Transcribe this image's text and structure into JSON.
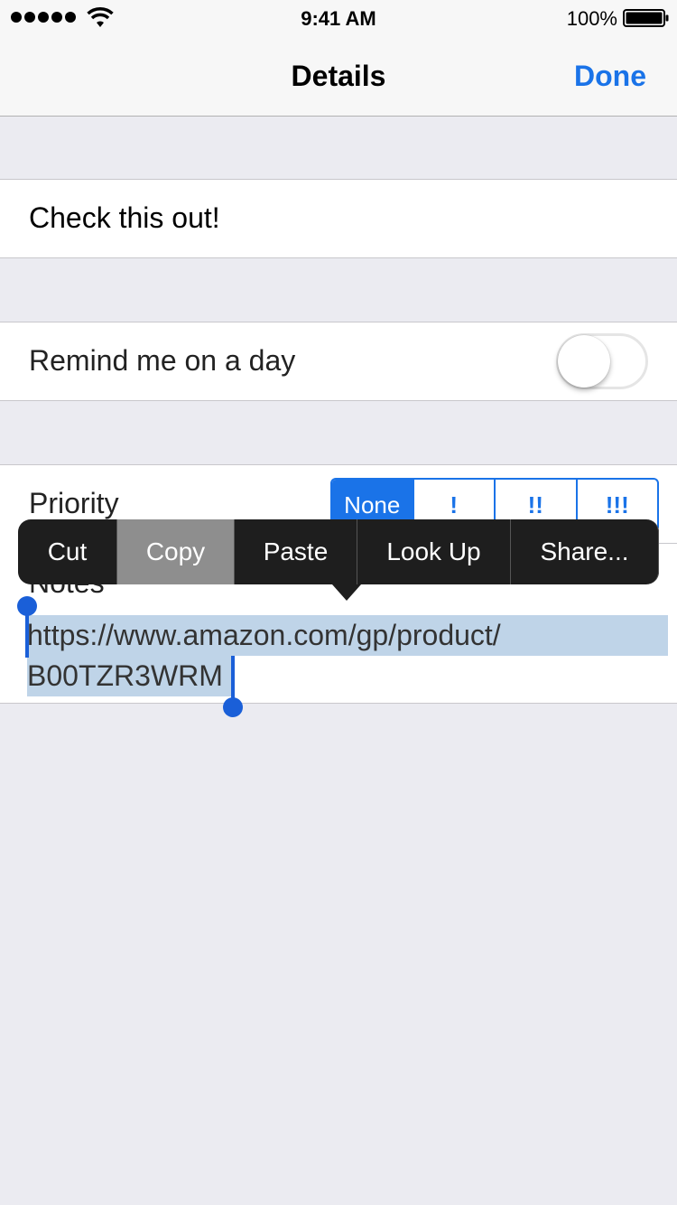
{
  "status_bar": {
    "time": "9:41 AM",
    "battery_percent": "100%",
    "signal_icon": "signal-dots-icon",
    "wifi_icon": "wifi-icon",
    "battery_icon": "battery-full-icon"
  },
  "nav": {
    "title": "Details",
    "done_label": "Done",
    "accent_color": "#1a73e8"
  },
  "reminder": {
    "title": "Check this out!"
  },
  "remind_me": {
    "label": "Remind me on a day",
    "enabled": false
  },
  "priority": {
    "label": "Priority",
    "options": [
      "None",
      "!",
      "!!",
      "!!!"
    ],
    "selected": "None"
  },
  "notes": {
    "label": "Notes",
    "line1": "https://www.amazon.com/gp/product/",
    "line2": "B00TZR3WRM",
    "selection_color": "#bfd4e8"
  },
  "edit_menu": {
    "items": [
      "Cut",
      "Copy",
      "Paste",
      "Look Up",
      "Share..."
    ],
    "highlighted": "Copy"
  }
}
